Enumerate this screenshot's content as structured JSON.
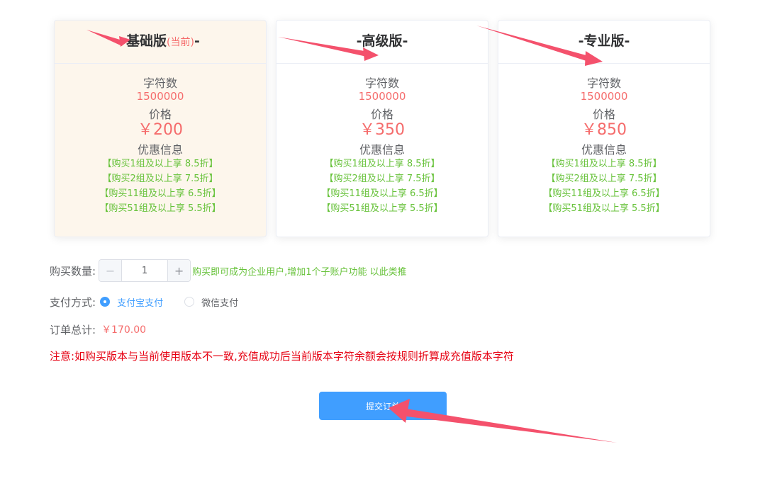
{
  "plans": [
    {
      "title": "-基础版",
      "current": "(当前)",
      "title_suffix": "-",
      "chars_label": "字符数",
      "chars_value": "1500000",
      "price_label": "价格",
      "price": "￥200",
      "discount_label": "优惠信息",
      "discounts": [
        "【购买1组及以上享 8.5折】",
        "【购买2组及以上享 7.5折】",
        "【购买11组及以上享 6.5折】",
        "【购买51组及以上享 5.5折】"
      ]
    },
    {
      "title": "-高级版-",
      "chars_label": "字符数",
      "chars_value": "1500000",
      "price_label": "价格",
      "price": "￥350",
      "discount_label": "优惠信息",
      "discounts": [
        "【购买1组及以上享 8.5折】",
        "【购买2组及以上享 7.5折】",
        "【购买11组及以上享 6.5折】",
        "【购买51组及以上享 5.5折】"
      ]
    },
    {
      "title": "-专业版-",
      "chars_label": "字符数",
      "chars_value": "1500000",
      "price_label": "价格",
      "price": "￥850",
      "discount_label": "优惠信息",
      "discounts": [
        "【购买1组及以上享 8.5折】",
        "【购买2组及以上享 7.5折】",
        "【购买11组及以上享 6.5折】",
        "【购买51组及以上享 5.5折】"
      ]
    }
  ],
  "quantity": {
    "label": "购买数量:",
    "minus": "−",
    "plus": "+",
    "value": "1",
    "tip": "购买即可成为企业用户,增加1个子账户功能 以此类推"
  },
  "payment": {
    "label": "支付方式:",
    "options": [
      {
        "label": "支付宝支付",
        "selected": true
      },
      {
        "label": "微信支付",
        "selected": false
      }
    ]
  },
  "total": {
    "label": "订单总计:",
    "value": "￥170.00"
  },
  "note": "注意:如购买版本与当前使用版本不一致,充值成功后当前版本字符余额会按规则折算成充值版本字符",
  "submit_label": "提交订单",
  "colors": {
    "accent": "#409eff",
    "price": "#f56c6c",
    "discount": "#67c23a",
    "warning": "#e60012",
    "annotation_arrow": "#f4516c",
    "active_card_bg": "#fdf6ec"
  }
}
